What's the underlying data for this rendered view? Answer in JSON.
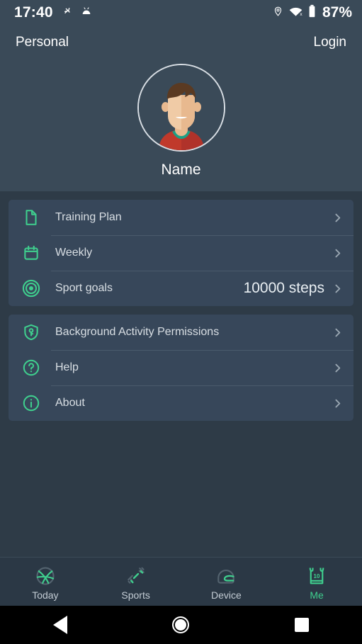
{
  "status_bar": {
    "time": "17:40",
    "battery_percent": "87%",
    "left_icons": [
      "airplane-mode-icon",
      "android-notification-icon"
    ],
    "right_icons": [
      "location-pin-icon",
      "wifi-off-icon",
      "battery-icon"
    ]
  },
  "app_bar": {
    "title": "Personal",
    "login_label": "Login"
  },
  "profile": {
    "name": "Name",
    "avatar_alt": "user-avatar"
  },
  "cards": [
    {
      "rows": [
        {
          "icon": "document-icon",
          "label": "Training Plan",
          "value": ""
        },
        {
          "icon": "calendar-icon",
          "label": "Weekly",
          "value": ""
        },
        {
          "icon": "target-icon",
          "label": "Sport goals",
          "value": "10000 steps"
        }
      ]
    },
    {
      "rows": [
        {
          "icon": "shield-key-icon",
          "label": "Background Activity Permissions",
          "value": ""
        },
        {
          "icon": "question-circle-icon",
          "label": "Help",
          "value": ""
        },
        {
          "icon": "info-circle-icon",
          "label": "About",
          "value": ""
        }
      ]
    }
  ],
  "tab_bar": {
    "tabs": [
      {
        "label": "Today",
        "icon": "basketball-icon",
        "active": false
      },
      {
        "label": "Sports",
        "icon": "dumbbell-icon",
        "active": false
      },
      {
        "label": "Device",
        "icon": "helmet-icon",
        "active": false
      },
      {
        "label": "Me",
        "icon": "jersey-icon",
        "active": true
      }
    ],
    "jersey_number": "10"
  },
  "android_nav": {
    "back_label": "Back",
    "home_label": "Home",
    "recents_label": "Recents"
  },
  "colors": {
    "header_bg": "#3a4a58",
    "body_bg": "#2e3b47",
    "card_bg": "#37475a",
    "accent_green": "#3fcf8e",
    "text_primary": "#ffffff",
    "text_secondary": "#d9dfe4",
    "tabbar_bg": "#2b3845"
  }
}
